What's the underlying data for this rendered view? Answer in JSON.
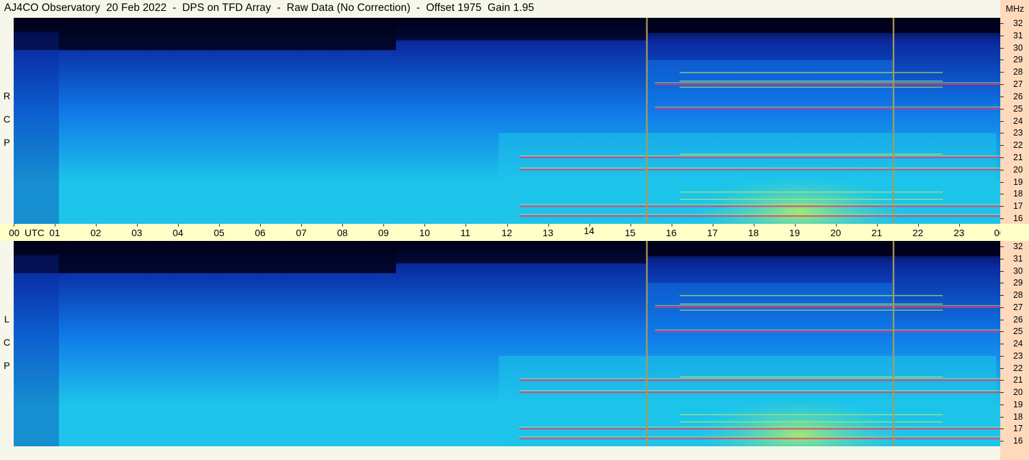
{
  "title": "AJ4CO Observatory  20 Feb 2022  -  DPS on TFD Array  -  Raw Data (No Correction)  -  Offset 1975  Gain 1.95",
  "panels": [
    {
      "id": "rcp",
      "label": [
        "R",
        "C",
        "P"
      ]
    },
    {
      "id": "lcp",
      "label": [
        "L",
        "C",
        "P"
      ]
    }
  ],
  "time_axis": {
    "first_label": "00",
    "unit": "UTC",
    "labels": [
      "01",
      "02",
      "03",
      "04",
      "05",
      "06",
      "07",
      "08",
      "09",
      "10",
      "11",
      "12",
      "13",
      "14",
      "15",
      "16",
      "17",
      "18",
      "19",
      "20",
      "21",
      "22",
      "23",
      "00"
    ]
  },
  "freq_axis": {
    "unit": "MHz",
    "labels": [
      "32",
      "31",
      "30",
      "29",
      "28",
      "27",
      "26",
      "25",
      "24",
      "23",
      "22",
      "21",
      "20",
      "19",
      "18",
      "17",
      "16"
    ]
  },
  "chart_data": [
    {
      "type": "heatmap",
      "polarization": "RCP",
      "x": {
        "label": "UTC",
        "range_hours": [
          0,
          24
        ]
      },
      "y": {
        "label": "MHz",
        "range": [
          16,
          32
        ]
      },
      "vertical_markers_utc": [
        15.4,
        21.4
      ],
      "interference_lines_mhz": [
        27.0,
        25.0,
        21.0,
        20.0,
        17.0,
        16.2
      ],
      "colors": {
        "low": "#000018",
        "mid_low": "#0a2aa0",
        "mid": "#0f78e8",
        "mid_high": "#1ec4ea",
        "high": "#b8f060",
        "peak": "#ff2a6a"
      }
    },
    {
      "type": "heatmap",
      "polarization": "LCP",
      "x": {
        "label": "UTC",
        "range_hours": [
          0,
          24
        ]
      },
      "y": {
        "label": "MHz",
        "range": [
          16,
          32
        ]
      },
      "vertical_markers_utc": [
        15.4,
        21.4
      ],
      "interference_lines_mhz": [
        27.0,
        25.0,
        21.0,
        20.0,
        17.0,
        16.2
      ],
      "colors": {
        "low": "#000018",
        "mid_low": "#0a2aa0",
        "mid": "#0f78e8",
        "mid_high": "#1ec4ea",
        "high": "#b8f060",
        "peak": "#ff2a6a"
      }
    }
  ]
}
